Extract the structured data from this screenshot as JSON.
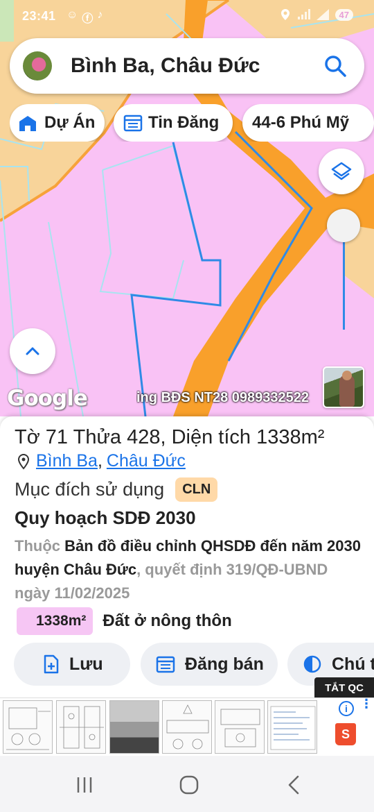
{
  "status": {
    "time": "23:41",
    "left_icons": [
      "☺",
      "ⓕ",
      "♪"
    ],
    "battery": "47"
  },
  "search": {
    "query": "Bình Ba, Châu Đức"
  },
  "chips": [
    {
      "label": "Dự Án",
      "icon": "building-icon"
    },
    {
      "label": "Tin Đăng",
      "icon": "calendar-list-icon"
    },
    {
      "label": "44-6 Phú Mỹ",
      "icon": "none"
    }
  ],
  "map": {
    "google_label": "Google",
    "watermark": "ing BĐS NT28 0989332522",
    "colors": {
      "residential": "#f9c2f5",
      "road": "#f9a02b",
      "farmland": "#f8d49a",
      "parcel_border": "#2f8ae6"
    }
  },
  "panel": {
    "parcel": {
      "to_label": "Tờ",
      "to_value": "71",
      "thua_label": "Thửa",
      "thua_value": "428",
      "area_label": ", Diện tích",
      "area_value": "1338m²"
    },
    "location": {
      "ward": "Bình Ba",
      "separator": ",",
      "district": "Châu Đức"
    },
    "purpose": {
      "label": "Mục đích sử dụng",
      "code": "CLN"
    },
    "plan": {
      "title": "Quy hoạch SDĐ 2030",
      "prefix": "Thuộc",
      "map_name": "Bản đồ điều chỉnh QHSDĐ đến năm 2030 huyện Châu Đức",
      "decision": ", quyết định 319/QĐ-UBND ngày 11/02/2025"
    },
    "zone": {
      "area": "1338m²",
      "label": "Đất ở nông thôn"
    },
    "actions": [
      {
        "label": "Lưu",
        "icon": "file-plus-icon"
      },
      {
        "label": "Đăng bán",
        "icon": "calendar-list-icon"
      },
      {
        "label": "Chú thích",
        "icon": "contrast-icon"
      }
    ]
  },
  "ad": {
    "close_label": "TẮT QC",
    "info_icon": "i",
    "more_icon": "⋮",
    "shopee_icon": "S"
  }
}
